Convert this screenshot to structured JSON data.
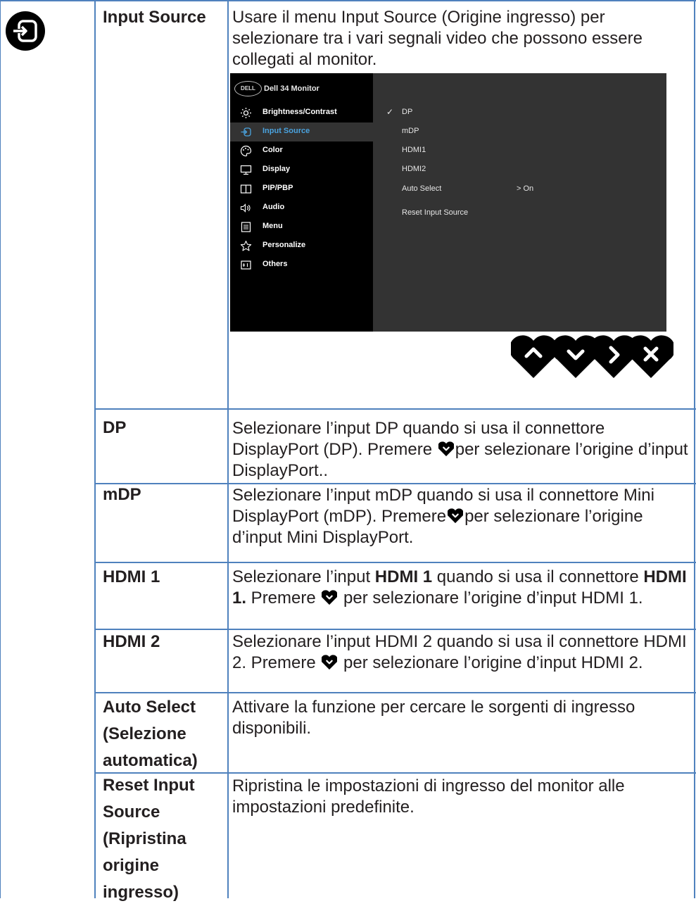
{
  "menu_icon": "input-source-icon",
  "header": {
    "label": "Input Source",
    "description": "Usare il menu Input Source (Origine ingresso) per selezionare tra i vari segnali video che possono essere collegati al monitor."
  },
  "osd": {
    "brand": "DELL",
    "title": "Dell 34 Monitor",
    "menu": [
      {
        "label": "Brightness/Contrast",
        "icon": "brightness-icon"
      },
      {
        "label": "Input Source",
        "icon": "input-source-icon",
        "active": true
      },
      {
        "label": "Color",
        "icon": "color-icon"
      },
      {
        "label": "Display",
        "icon": "display-icon"
      },
      {
        "label": "PIP/PBP",
        "icon": "pip-pbp-icon"
      },
      {
        "label": "Audio",
        "icon": "audio-icon"
      },
      {
        "label": "Menu",
        "icon": "menu-icon"
      },
      {
        "label": "Personalize",
        "icon": "star-icon"
      },
      {
        "label": "Others",
        "icon": "others-icon"
      }
    ],
    "options": [
      "DP",
      "mDP",
      "HDMI1",
      "HDMI2",
      "Auto Select",
      "Reset Input Source"
    ],
    "selected_option": "DP",
    "auto_select_value": "> On",
    "check_mark": "✓"
  },
  "nav_buttons": [
    "up-icon",
    "down-icon",
    "right-icon",
    "close-icon"
  ],
  "rows": [
    {
      "label": "DP",
      "desc_1": "Selezionare l’input DP quando si usa il connettore DisplayPort (DP). Premere ",
      "desc_2": "per selezionare l’origine d’input DisplayPort.."
    },
    {
      "label": "mDP",
      "desc_1": "Selezionare l’input mDP quando si usa il connettore Mini DisplayPort (mDP). Premere",
      "desc_2": "per selezionare l’origine d’input Mini DisplayPort."
    },
    {
      "label": "HDMI 1",
      "desc_1": "Selezionare l’input ",
      "desc_bold_1": "HDMI 1",
      "desc_2": " quando si usa il connettore ",
      "desc_bold_2": "HDMI 1.",
      "desc_3": " Premere ",
      "desc_4": " per selezionare l’origine d’input HDMI 1."
    },
    {
      "label": "HDMI 2",
      "desc_1": "Selezionare l’input HDMI 2 quando si usa il connettore HDMI 2. Premere ",
      "desc_2": " per selezionare l’origine d’input HDMI 2."
    },
    {
      "label_1": "Auto Select",
      "label_2": "(Selezione",
      "label_3": "automatica)",
      "desc": "Attivare la funzione per cercare le sorgenti di ingresso disponibili."
    },
    {
      "label_1": "Reset Input",
      "label_2": "Source",
      "label_3": "(Ripristina",
      "label_4": "origine",
      "label_5": "ingresso)",
      "desc": "Ripristina le impostazioni di ingresso del monitor alle impostazioni predefinite."
    }
  ],
  "colors": {
    "border": "#4f81bd",
    "osd_left": "#000000",
    "osd_right": "#333333",
    "active_text": "#4aa3df"
  }
}
